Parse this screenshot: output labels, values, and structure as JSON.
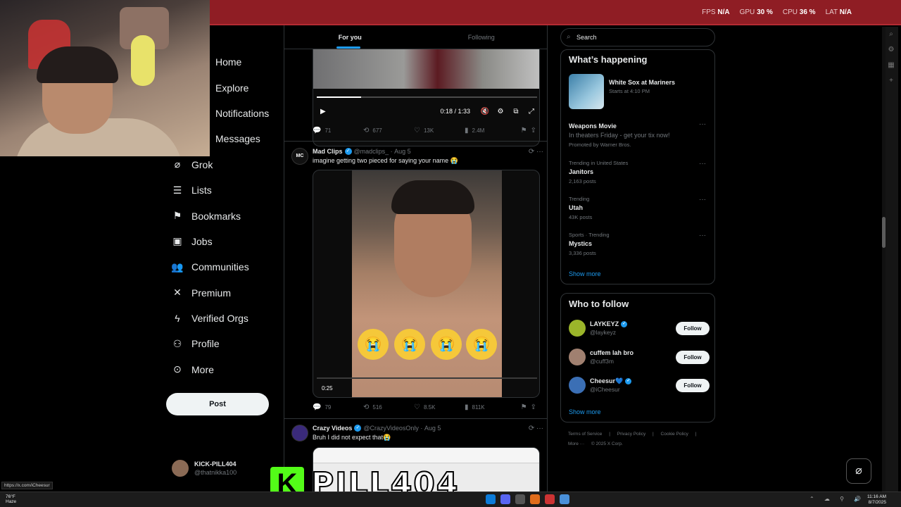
{
  "hud": {
    "fps_label": "FPS",
    "fps_value": "N/A",
    "gpu_label": "GPU",
    "gpu_value": "30 %",
    "cpu_label": "CPU",
    "cpu_value": "36 %",
    "lat_label": "LAT",
    "lat_value": "N/A"
  },
  "nav": {
    "items": [
      {
        "label": "Home",
        "icon": "home-icon"
      },
      {
        "label": "Explore",
        "icon": "search-icon"
      },
      {
        "label": "Notifications",
        "icon": "bell-icon"
      },
      {
        "label": "Messages",
        "icon": "mail-icon"
      },
      {
        "label": "Grok",
        "icon": "grok-icon"
      },
      {
        "label": "Lists",
        "icon": "list-icon"
      },
      {
        "label": "Bookmarks",
        "icon": "bookmark-icon"
      },
      {
        "label": "Jobs",
        "icon": "briefcase-icon"
      },
      {
        "label": "Communities",
        "icon": "people-icon"
      },
      {
        "label": "Premium",
        "icon": "x-logo-icon"
      },
      {
        "label": "Verified Orgs",
        "icon": "lightning-icon"
      },
      {
        "label": "Profile",
        "icon": "person-icon"
      },
      {
        "label": "More",
        "icon": "more-circle-icon"
      }
    ],
    "post_label": "Post",
    "account": {
      "name": "KICK-PILL404",
      "handle": "@thatnikka100"
    }
  },
  "feed": {
    "tabs": [
      {
        "label": "For you",
        "active": true
      },
      {
        "label": "Following",
        "active": false
      }
    ],
    "video1": {
      "time": "0:18 / 1:33",
      "progress": 0.2
    },
    "stats1": {
      "replies": "71",
      "reposts": "677",
      "likes": "13K",
      "views": "2.4M"
    },
    "tweet2": {
      "avatar_text": "MC",
      "name": "Mad Clips",
      "handle": "@madclips_",
      "date": "Aug 5",
      "text": "imagine getting two pieced for saying your name 😭",
      "video_time": "0:25",
      "emojis": [
        "😭",
        "😭",
        "😭",
        "😭"
      ]
    },
    "stats2": {
      "replies": "79",
      "reposts": "516",
      "likes": "8.5K",
      "views": "811K"
    },
    "tweet3": {
      "name": "Crazy Videos",
      "handle": "@CrazyVideosOnly",
      "date": "Aug 5",
      "text": "Bruh I did not expect that😭"
    }
  },
  "right": {
    "search_placeholder": "Search",
    "happening_title": "What’s happening",
    "sport": {
      "title": "White Sox at Mariners",
      "context": "Starts at 4:10 PM"
    },
    "promo": {
      "title": "Weapons Movie",
      "desc": "In theaters Friday - get your tix now!",
      "promoted": "Promoted by Warner Bros."
    },
    "trends": [
      {
        "context": "Trending in United States",
        "title": "Janitors",
        "posts": "2,163 posts"
      },
      {
        "context": "Trending",
        "title": "Utah",
        "posts": "43K posts"
      },
      {
        "context": "Sports · Trending",
        "title": "Mystics",
        "posts": "3,336 posts"
      }
    ],
    "show_more": "Show more",
    "who_title": "Who to follow",
    "follow": [
      {
        "name": "LAYKEYZ",
        "handle": "@laykeyz",
        "verified": true,
        "color": "#9bb52a"
      },
      {
        "name": "cuffem lah bro",
        "handle": "@cuff3m",
        "verified": false,
        "color": "#a08070"
      },
      {
        "name": "Cheesur💙",
        "handle": "@iCheesur",
        "verified": true,
        "color": "#3b6fb5"
      }
    ],
    "follow_label": "Follow",
    "footer": [
      "Terms of Service",
      "|",
      "Privacy Policy",
      "|",
      "Cookie Policy",
      "|"
    ],
    "footer2": [
      "More ···",
      "© 2025 X Corp."
    ]
  },
  "overlay": {
    "brand_k": "K",
    "brand_text": "PILL404",
    "url_tip": "https://x.com/iCheesur"
  },
  "taskbar": {
    "temp": "76°F",
    "weather": "Haze",
    "time": "11:16 AM",
    "date": "8/7/2025"
  },
  "colors": {
    "accent": "#1d9bf0",
    "topbar": "#8f1d24",
    "kick": "#53fc18"
  }
}
